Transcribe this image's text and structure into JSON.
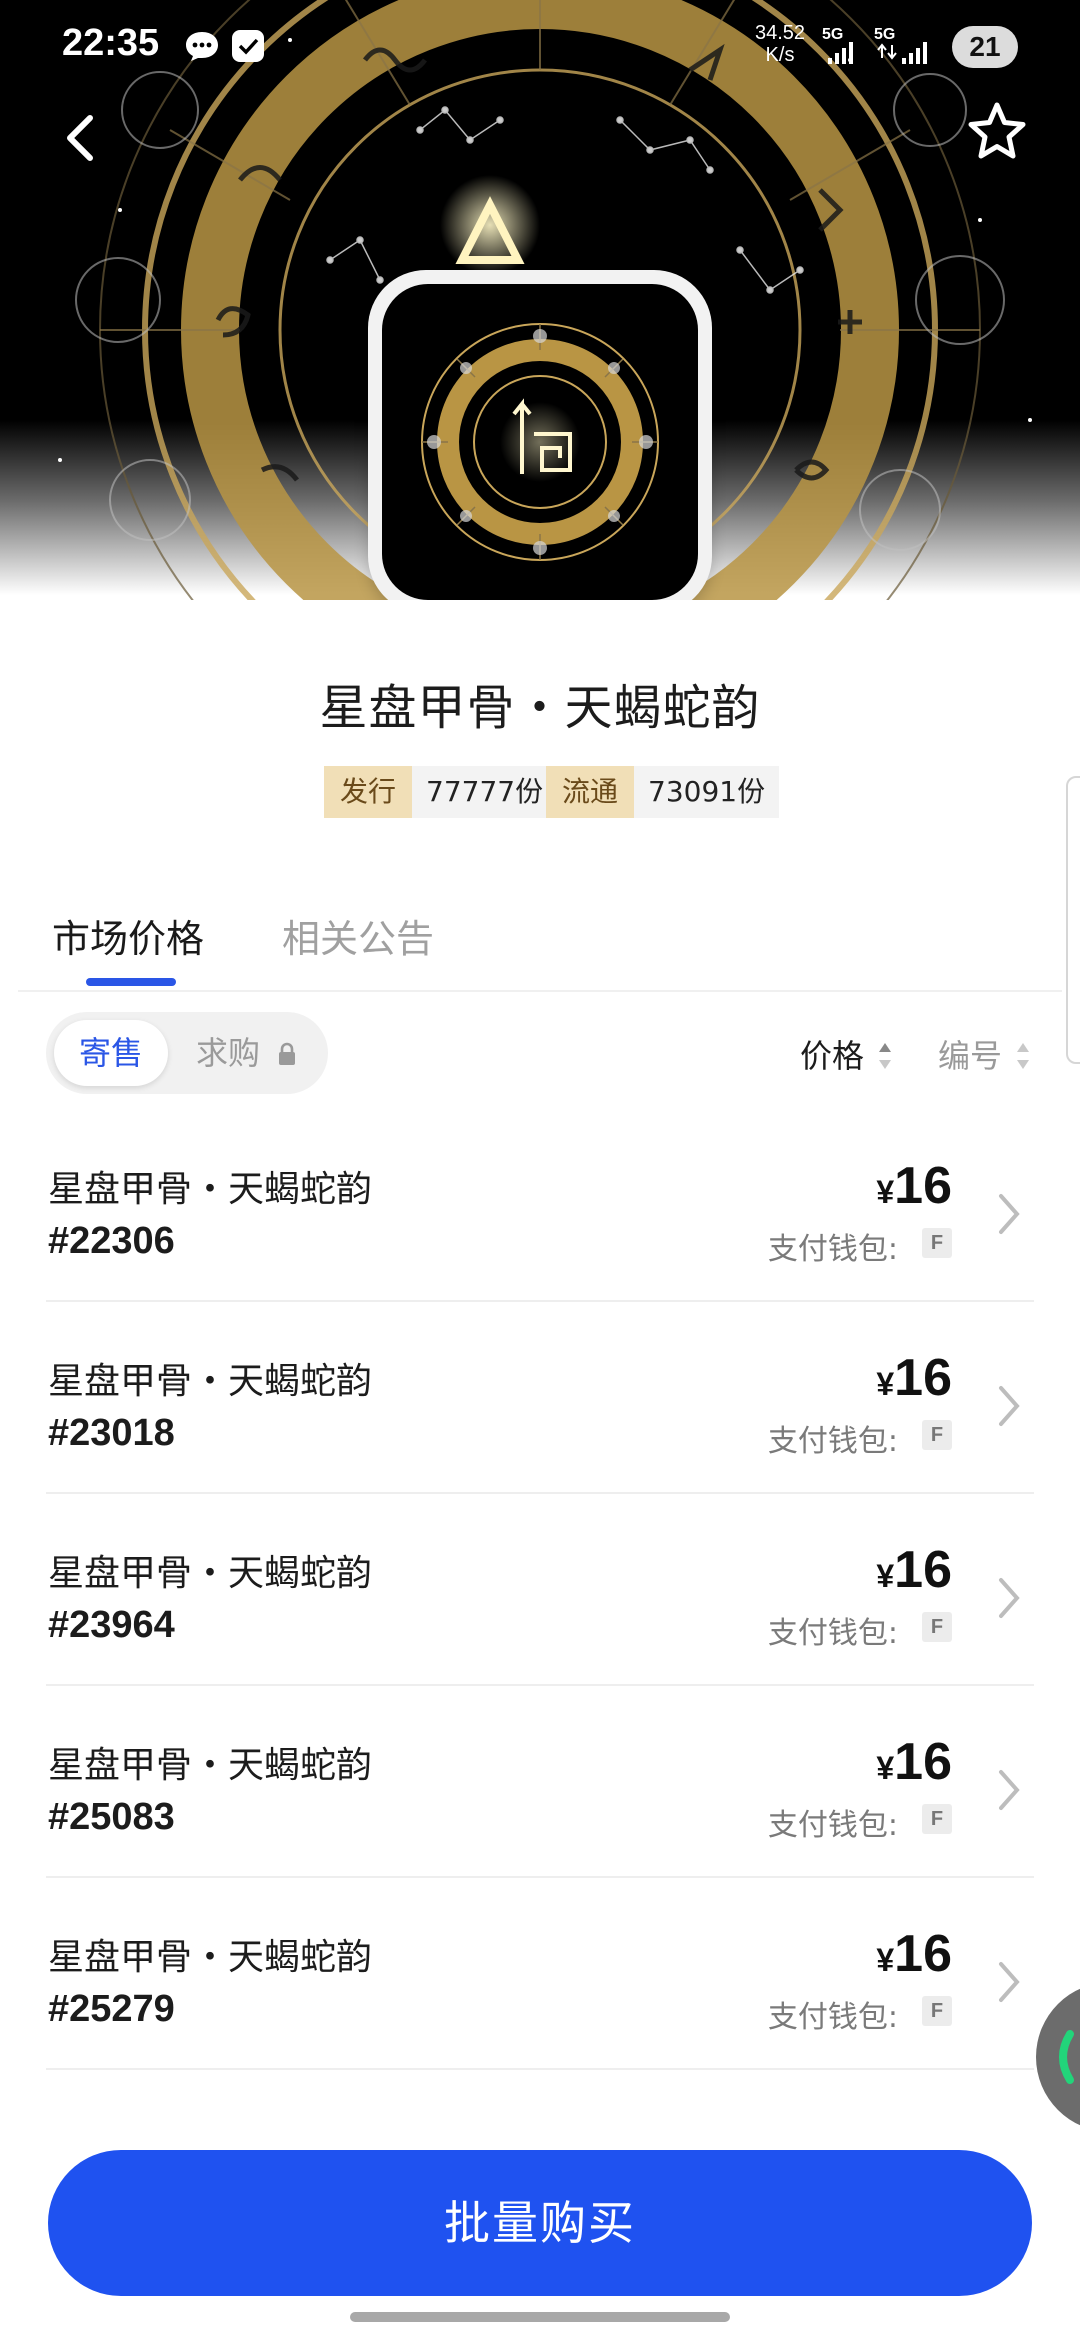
{
  "status_bar": {
    "time": "22:35",
    "speed_value": "34.52",
    "speed_unit": "K/s",
    "net1_label": "5G",
    "net2_label": "5G",
    "battery": "21"
  },
  "nav": {
    "back_icon": "chevron-left-icon",
    "favorite_icon": "star-outline-icon"
  },
  "product": {
    "title": "星盘甲骨・天蝎蛇韵",
    "issued_tag": "发行",
    "issued_value": "77777份",
    "circulating_tag": "流通",
    "circulating_value": "73091份"
  },
  "tabs": {
    "market": "市场价格",
    "announcements": "相关公告",
    "active_tab": "market"
  },
  "filters": {
    "sell": "寄售",
    "buy": "求购",
    "active": "sell",
    "sort_price": "价格",
    "sort_number": "编号"
  },
  "listings": [
    {
      "name": "星盘甲骨・天蝎蛇韵",
      "number": "#22306",
      "currency": "¥",
      "price": "16",
      "wallet_label": "支付钱包:",
      "wallet_badge": "F"
    },
    {
      "name": "星盘甲骨・天蝎蛇韵",
      "number": "#23018",
      "currency": "¥",
      "price": "16",
      "wallet_label": "支付钱包:",
      "wallet_badge": "F"
    },
    {
      "name": "星盘甲骨・天蝎蛇韵",
      "number": "#23964",
      "currency": "¥",
      "price": "16",
      "wallet_label": "支付钱包:",
      "wallet_badge": "F"
    },
    {
      "name": "星盘甲骨・天蝎蛇韵",
      "number": "#25083",
      "currency": "¥",
      "price": "16",
      "wallet_label": "支付钱包:",
      "wallet_badge": "F"
    },
    {
      "name": "星盘甲骨・天蝎蛇韵",
      "number": "#25279",
      "currency": "¥",
      "price": "16",
      "wallet_label": "支付钱包:",
      "wallet_badge": "F"
    }
  ],
  "footer": {
    "bulk_buy": "批量购买"
  },
  "colors": {
    "accent": "#1f52f0",
    "tag_bg": "#f1dfb7",
    "gold": "#c9a65a"
  }
}
